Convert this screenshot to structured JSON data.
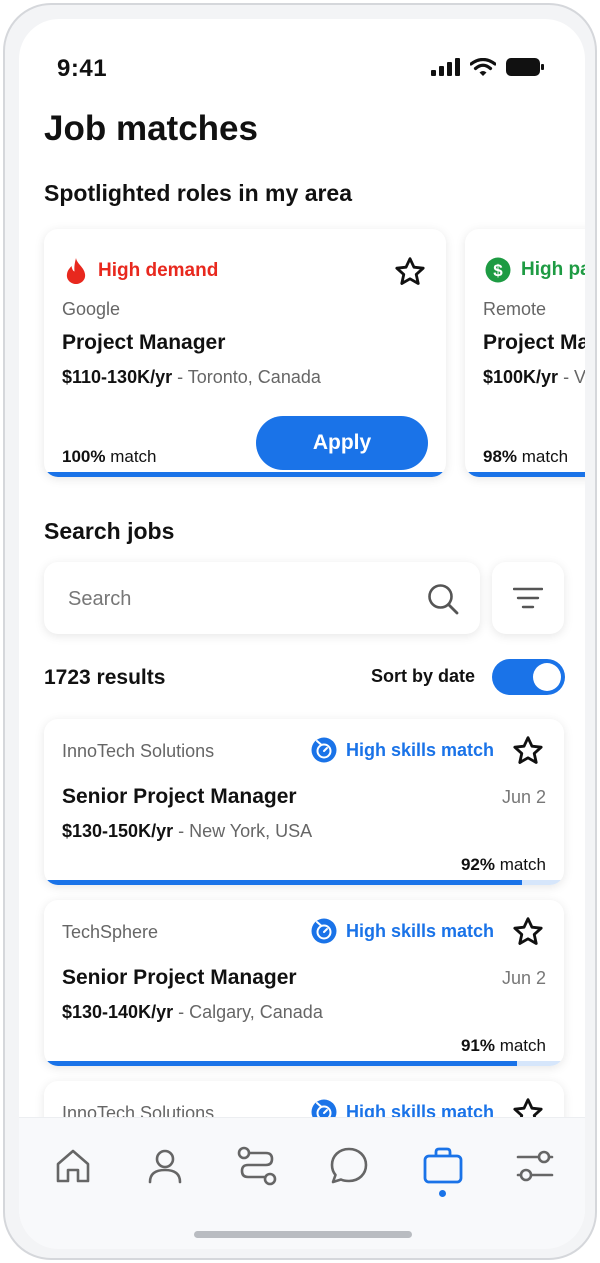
{
  "status_bar": {
    "time": "9:41"
  },
  "page": {
    "title": "Job matches"
  },
  "spotlight": {
    "section_title": "Spotlighted roles in my area",
    "cards": [
      {
        "badge": "High demand",
        "badge_icon": "flame-icon",
        "badge_color": "#e8281e",
        "company": "Google",
        "role": "Project Manager",
        "salary": "$110-130K/yr",
        "location": " - Toronto, Canada",
        "match_value": "100%",
        "match_label": " match",
        "apply_label": "Apply"
      },
      {
        "badge": "High pa",
        "badge_icon": "dollar-icon",
        "badge_color": "#1e9b43",
        "company": "Remote",
        "role": "Project Ma",
        "salary": "$100K/yr",
        "location": " - V",
        "match_value": "98%",
        "match_label": " match"
      }
    ]
  },
  "search": {
    "section_title": "Search jobs",
    "placeholder": "Search",
    "results_count": "1723 results",
    "sort_label": "Sort by date",
    "sort_by_date": true
  },
  "jobs": [
    {
      "company": "InnoTech Solutions",
      "badge": "High skills match",
      "title": "Senior Project Manager",
      "date": "Jun 2",
      "salary": "$130-150K/yr",
      "location": " - New York, USA",
      "match_value": "92%",
      "match_label": " match",
      "match_fraction": 0.92
    },
    {
      "company": "TechSphere",
      "badge": "High skills match",
      "title": "Senior Project Manager",
      "date": "Jun 2",
      "salary": "$130-140K/yr",
      "location": " - Calgary, Canada",
      "match_value": "91%",
      "match_label": " match",
      "match_fraction": 0.91
    },
    {
      "company": "InnoTech Solutions",
      "badge": "High skills match"
    }
  ],
  "nav": {
    "items": [
      "home-icon",
      "profile-icon",
      "route-icon",
      "chat-icon",
      "briefcase-icon",
      "settings-icon"
    ],
    "active": "briefcase-icon"
  },
  "colors": {
    "accent": "#1a73e8",
    "demand": "#e8281e",
    "pay": "#1e9b43"
  }
}
